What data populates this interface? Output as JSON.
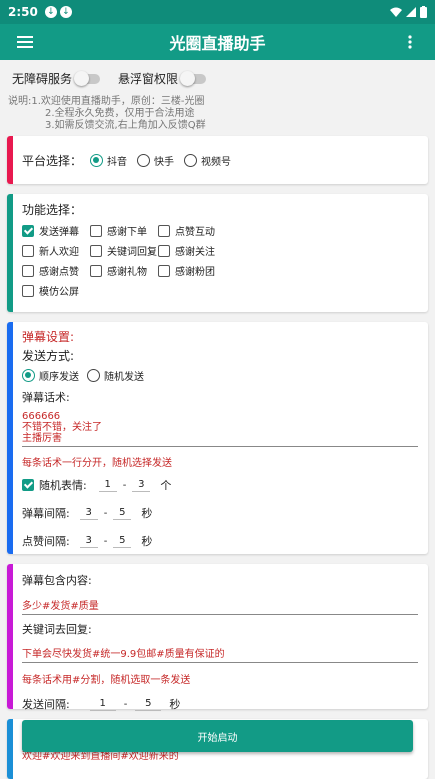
{
  "status": {
    "time": "2:50"
  },
  "appbar": {
    "title": "光圈直播助手"
  },
  "top": {
    "accessibility": "无障碍服务",
    "float_perm": "悬浮窗权限"
  },
  "desc": [
    "说明:1.欢迎使用直播助手，原创：三楼-光圈",
    "2.全程永久免费，仅用于合法用途",
    "3.如需反馈交流,右上角加入反馈Q群"
  ],
  "platform": {
    "label": "平台选择：",
    "options": [
      "抖音",
      "快手",
      "视频号"
    ],
    "selected": "抖音"
  },
  "functions": {
    "label": "功能选择：",
    "items": [
      {
        "label": "发送弹幕",
        "checked": true
      },
      {
        "label": "感谢下单",
        "checked": false
      },
      {
        "label": "点赞互动",
        "checked": false
      },
      {
        "label": "新人欢迎",
        "checked": false
      },
      {
        "label": "关键词回复",
        "checked": false
      },
      {
        "label": "感谢关注",
        "checked": false
      },
      {
        "label": "感谢点赞",
        "checked": false
      },
      {
        "label": "感谢礼物",
        "checked": false
      },
      {
        "label": "感谢粉团",
        "checked": false
      },
      {
        "label": "模仿公屏",
        "checked": false
      }
    ]
  },
  "danmu": {
    "title": "弹幕设置:",
    "send_mode_label": "发送方式:",
    "modes": [
      "顺序发送",
      "随机发送"
    ],
    "mode_selected": "顺序发送",
    "phrases_label": "弹幕话术:",
    "phrases": [
      "666666",
      "不错不错，关注了",
      "主播厉害"
    ],
    "hint": "每条话术一行分开，随机选择发送",
    "random_emoji_label": "随机表情:",
    "emoji_min": "1",
    "emoji_max": "3",
    "emoji_unit": "个",
    "interval_label": "弹幕间隔:",
    "interval_min": "3",
    "interval_max": "5",
    "like_label": "点赞间隔:",
    "like_min": "3",
    "like_max": "5",
    "sec": "秒",
    "dash": "-"
  },
  "keyword": {
    "contains_label": "弹幕包含内容:",
    "contains_value": "多少#发货#质量",
    "reply_label": "关键词去回复:",
    "reply_value": "下单会尽快发货#统一9.9包邮#质量有保证的",
    "hint": "每条话术用#分割，随机选取一条发送",
    "interval_label": "发送间隔:",
    "interval_min": "1",
    "interval_max": "5",
    "sec": "秒",
    "dash": "-"
  },
  "welcome": {
    "value": "欢迎#欢迎来到直播间#欢迎新来的"
  },
  "start": {
    "label": "开始启动"
  },
  "colors": {
    "primary": "#129b86",
    "card1": "#e8194f",
    "card2": "#129b86",
    "card3": "#1a6cf0",
    "card4": "#c81ad6",
    "card5": "#1b8fd6"
  }
}
